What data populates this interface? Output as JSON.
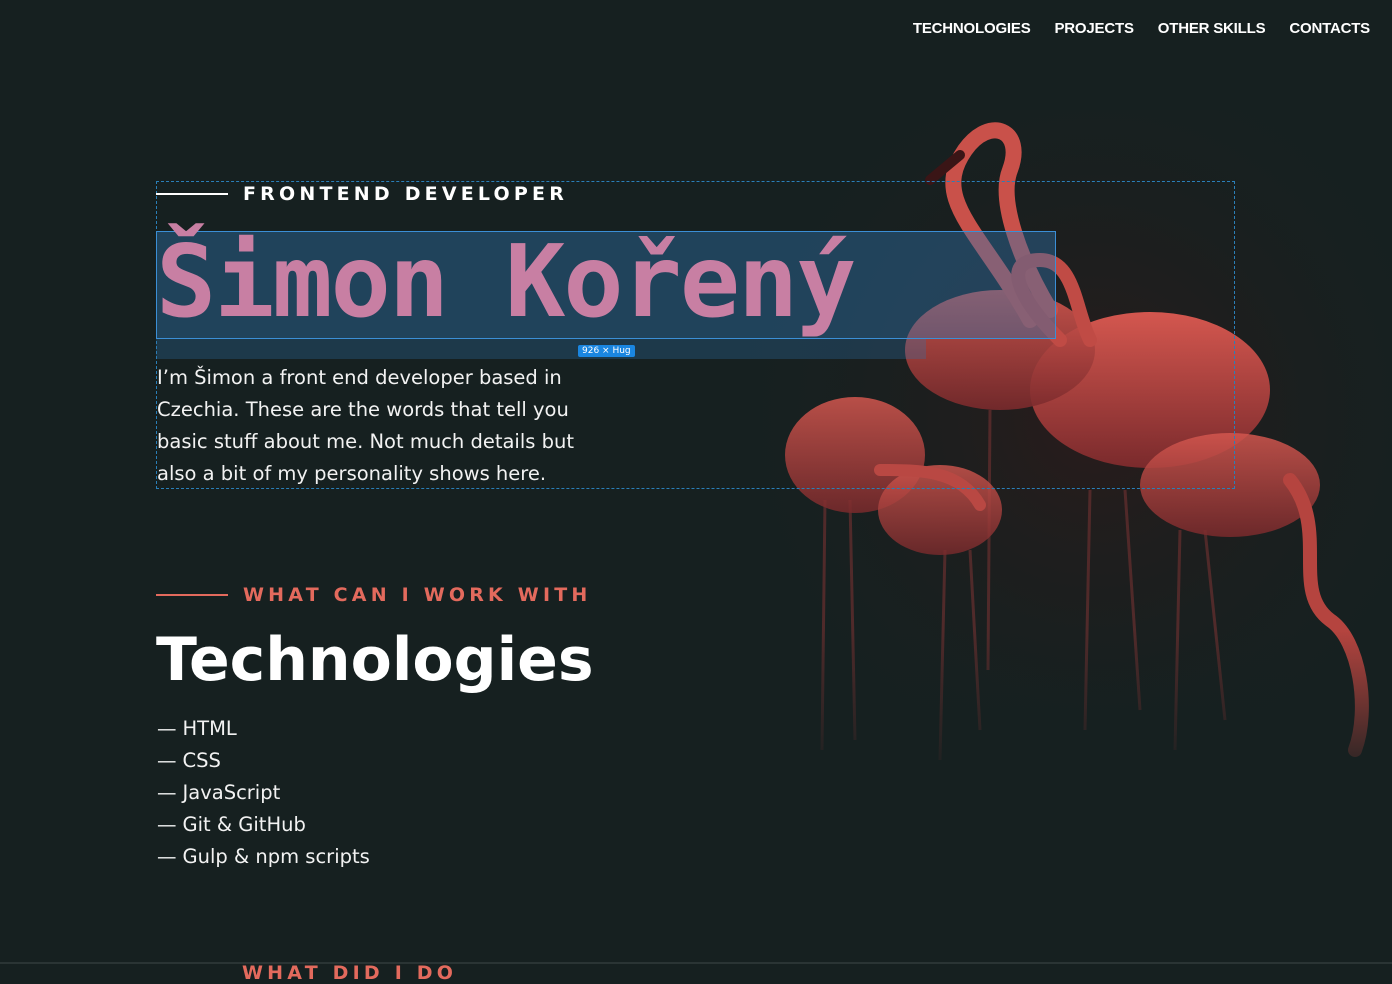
{
  "nav": {
    "items": [
      {
        "label": "TECHNOLOGIES"
      },
      {
        "label": "PROJECTS"
      },
      {
        "label": "OTHER SKILLS"
      },
      {
        "label": "CONTACTS"
      }
    ]
  },
  "hero": {
    "eyebrow": "FRONTEND DEVELOPER",
    "name": "Šimon Kořený",
    "intro": "I’m Šimon a front end developer based in Czechia. These are the words that tell you basic stuff about me. Not much details but also a bit of my personality shows here."
  },
  "editor_overlay": {
    "size_badge": "926 × Hug"
  },
  "technologies": {
    "eyebrow": "WHAT CAN I WORK WITH",
    "title": "Technologies",
    "dash": "—",
    "items": [
      "HTML",
      "CSS",
      "JavaScript",
      "Git & GitHub",
      "Gulp & npm scripts"
    ]
  },
  "next_section": {
    "eyebrow": "WHAT DID I DO"
  },
  "colors": {
    "background": "#162020",
    "accent": "#e36a5d",
    "name_pink": "#c87fa3",
    "selection_blue": "#1a86e0"
  },
  "icons": [
    "flamingo-photo"
  ]
}
